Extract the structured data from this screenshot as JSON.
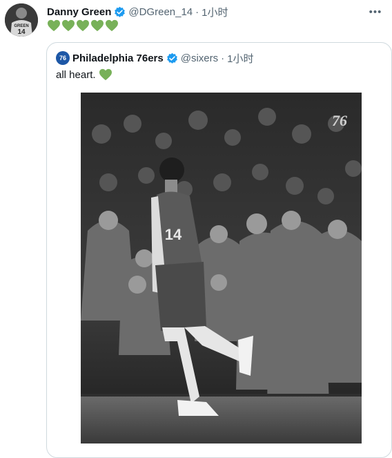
{
  "tweet": {
    "author_name": "Danny Green",
    "author_handle": "@DGreen_14",
    "separator": "·",
    "timestamp": "1小时",
    "more_icon": "more-icon",
    "body_emoji": [
      "green-heart",
      "green-heart",
      "green-heart",
      "green-heart",
      "green-heart"
    ],
    "avatar_jersey_text": "GREEN",
    "avatar_jersey_number": "14"
  },
  "quoted": {
    "author_name": "Philadelphia 76ers",
    "author_handle": "@sixers",
    "separator": "·",
    "timestamp": "1小时",
    "avatar_text": "76",
    "text": "all heart.",
    "text_emoji": "green-heart",
    "photo": {
      "jersey_number": "14",
      "logo_text": "76"
    }
  },
  "colors": {
    "verified_blue": "#1d9bf0",
    "heart_green": "#78b159",
    "border": "#cfd9de",
    "secondary_text": "#536471"
  }
}
